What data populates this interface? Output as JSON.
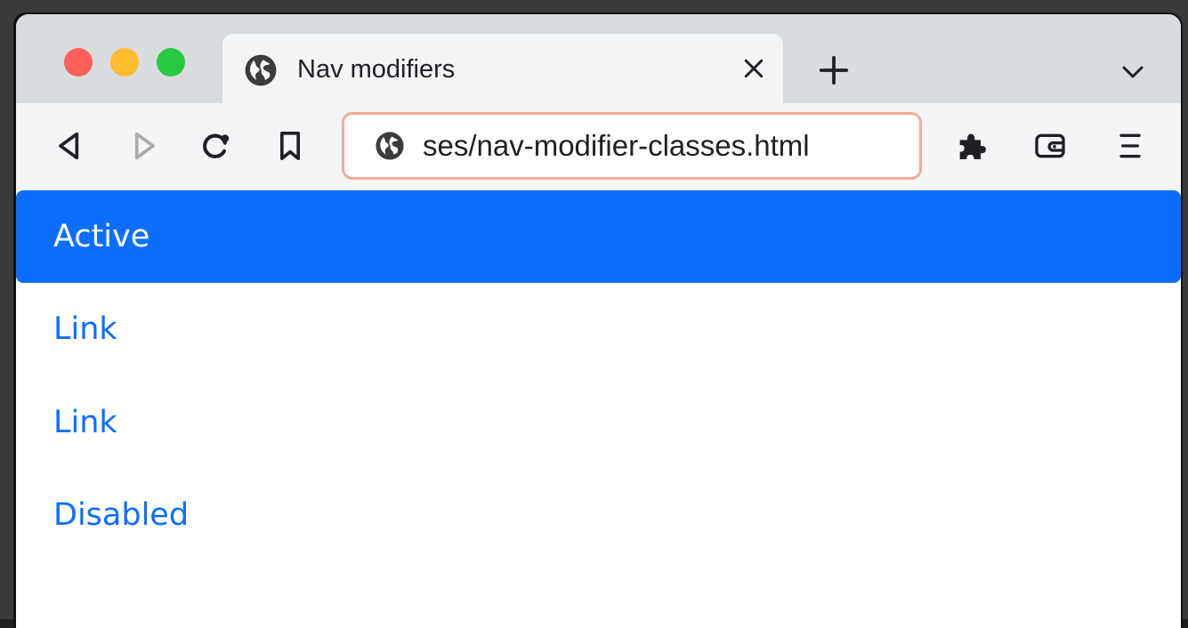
{
  "tab": {
    "title": "Nav modifiers",
    "favicon": "globe-icon",
    "close": "close-icon"
  },
  "window_controls": {
    "close_color": "#fe5f57",
    "minimize_color": "#febc2e",
    "maximize_color": "#28c840"
  },
  "toolbar": {
    "icons": [
      "back-icon",
      "forward-icon",
      "reload-icon",
      "bookmark-icon",
      "extensions-icon",
      "wallet-icon",
      "menu-icon"
    ],
    "url": "ses/nav-modifier-classes.html"
  },
  "nav": {
    "accent_color": "#0d6efd",
    "items": [
      {
        "label": "Active",
        "state": "active"
      },
      {
        "label": "Link",
        "state": "normal"
      },
      {
        "label": "Link",
        "state": "normal"
      },
      {
        "label": "Disabled",
        "state": "disabled"
      }
    ]
  }
}
